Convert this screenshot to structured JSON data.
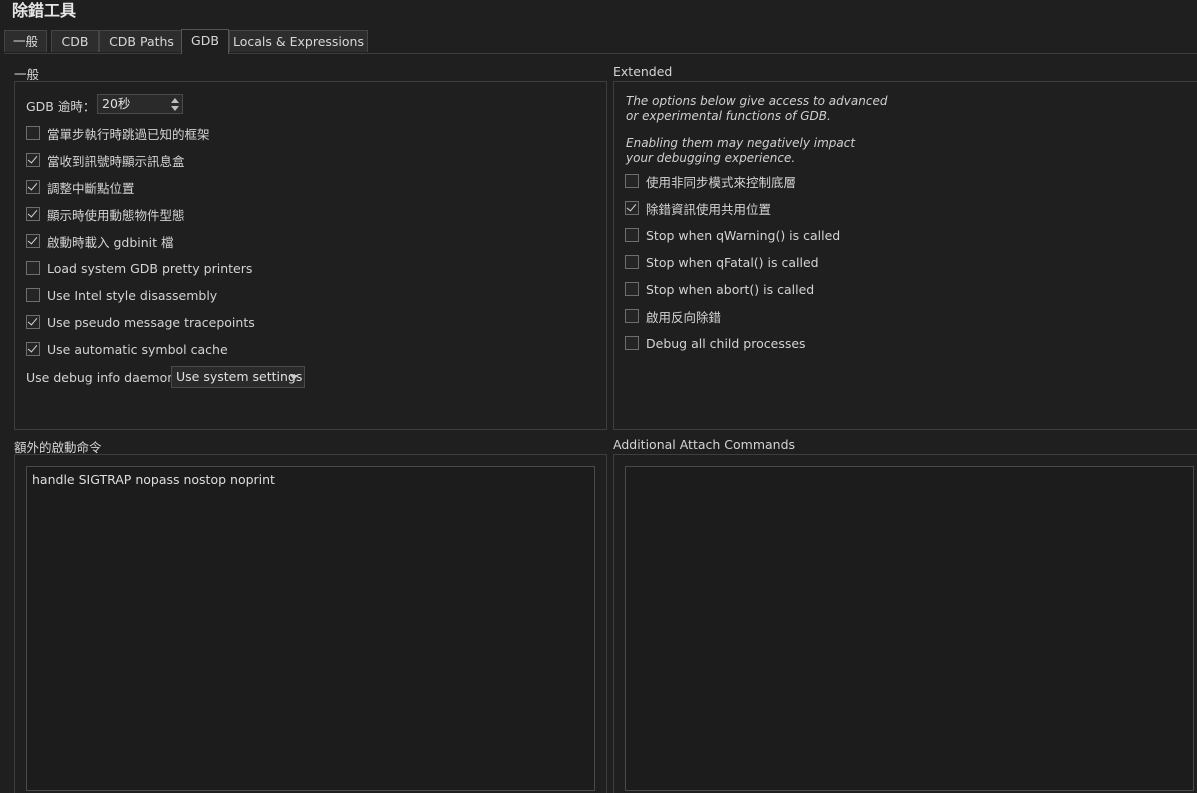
{
  "window": {
    "title": "除錯工具"
  },
  "tabs": [
    {
      "label": "一般",
      "active": false
    },
    {
      "label": "CDB",
      "active": false
    },
    {
      "label": "CDB Paths",
      "active": false
    },
    {
      "label": "GDB",
      "active": true
    },
    {
      "label": "Locals & Expressions",
      "active": false
    }
  ],
  "general": {
    "title": "一般",
    "timeout_label": "GDB 逾時：",
    "timeout_value": "20秒",
    "options": [
      {
        "label": "當單步執行時跳過已知的框架",
        "checked": false
      },
      {
        "label": "當收到訊號時顯示訊息盒",
        "checked": true
      },
      {
        "label": "調整中斷點位置",
        "checked": true
      },
      {
        "label": "顯示時使用動態物件型態",
        "checked": true
      },
      {
        "label": "啟動時載入 gdbinit 檔",
        "checked": true
      },
      {
        "label": "Load system GDB pretty printers",
        "checked": false
      },
      {
        "label": "Use Intel style disassembly",
        "checked": false
      },
      {
        "label": "Use pseudo message tracepoints",
        "checked": true
      },
      {
        "label": "Use automatic symbol cache",
        "checked": true
      }
    ],
    "daemon_label": "Use debug info daemon",
    "daemon_value": "Use system settings"
  },
  "extended": {
    "title": "Extended",
    "note1_line1": "The options below give access to advanced",
    "note1_line2": "or experimental functions of GDB.",
    "note2_line1": "Enabling them may negatively impact",
    "note2_line2": "your debugging experience.",
    "options": [
      {
        "label": "使用非同步模式來控制底層",
        "checked": false
      },
      {
        "label": "除錯資訊使用共用位置",
        "checked": true
      },
      {
        "label": "Stop when qWarning() is called",
        "checked": false
      },
      {
        "label": "Stop when qFatal() is called",
        "checked": false
      },
      {
        "label": "Stop when abort() is called",
        "checked": false
      },
      {
        "label": "啟用反向除錯",
        "checked": false
      },
      {
        "label": "Debug all child processes",
        "checked": false
      }
    ]
  },
  "startup_commands": {
    "title": "額外的啟動命令",
    "value": "handle SIGTRAP nopass nostop noprint"
  },
  "attach_commands": {
    "title": "Additional Attach Commands",
    "value": ""
  }
}
